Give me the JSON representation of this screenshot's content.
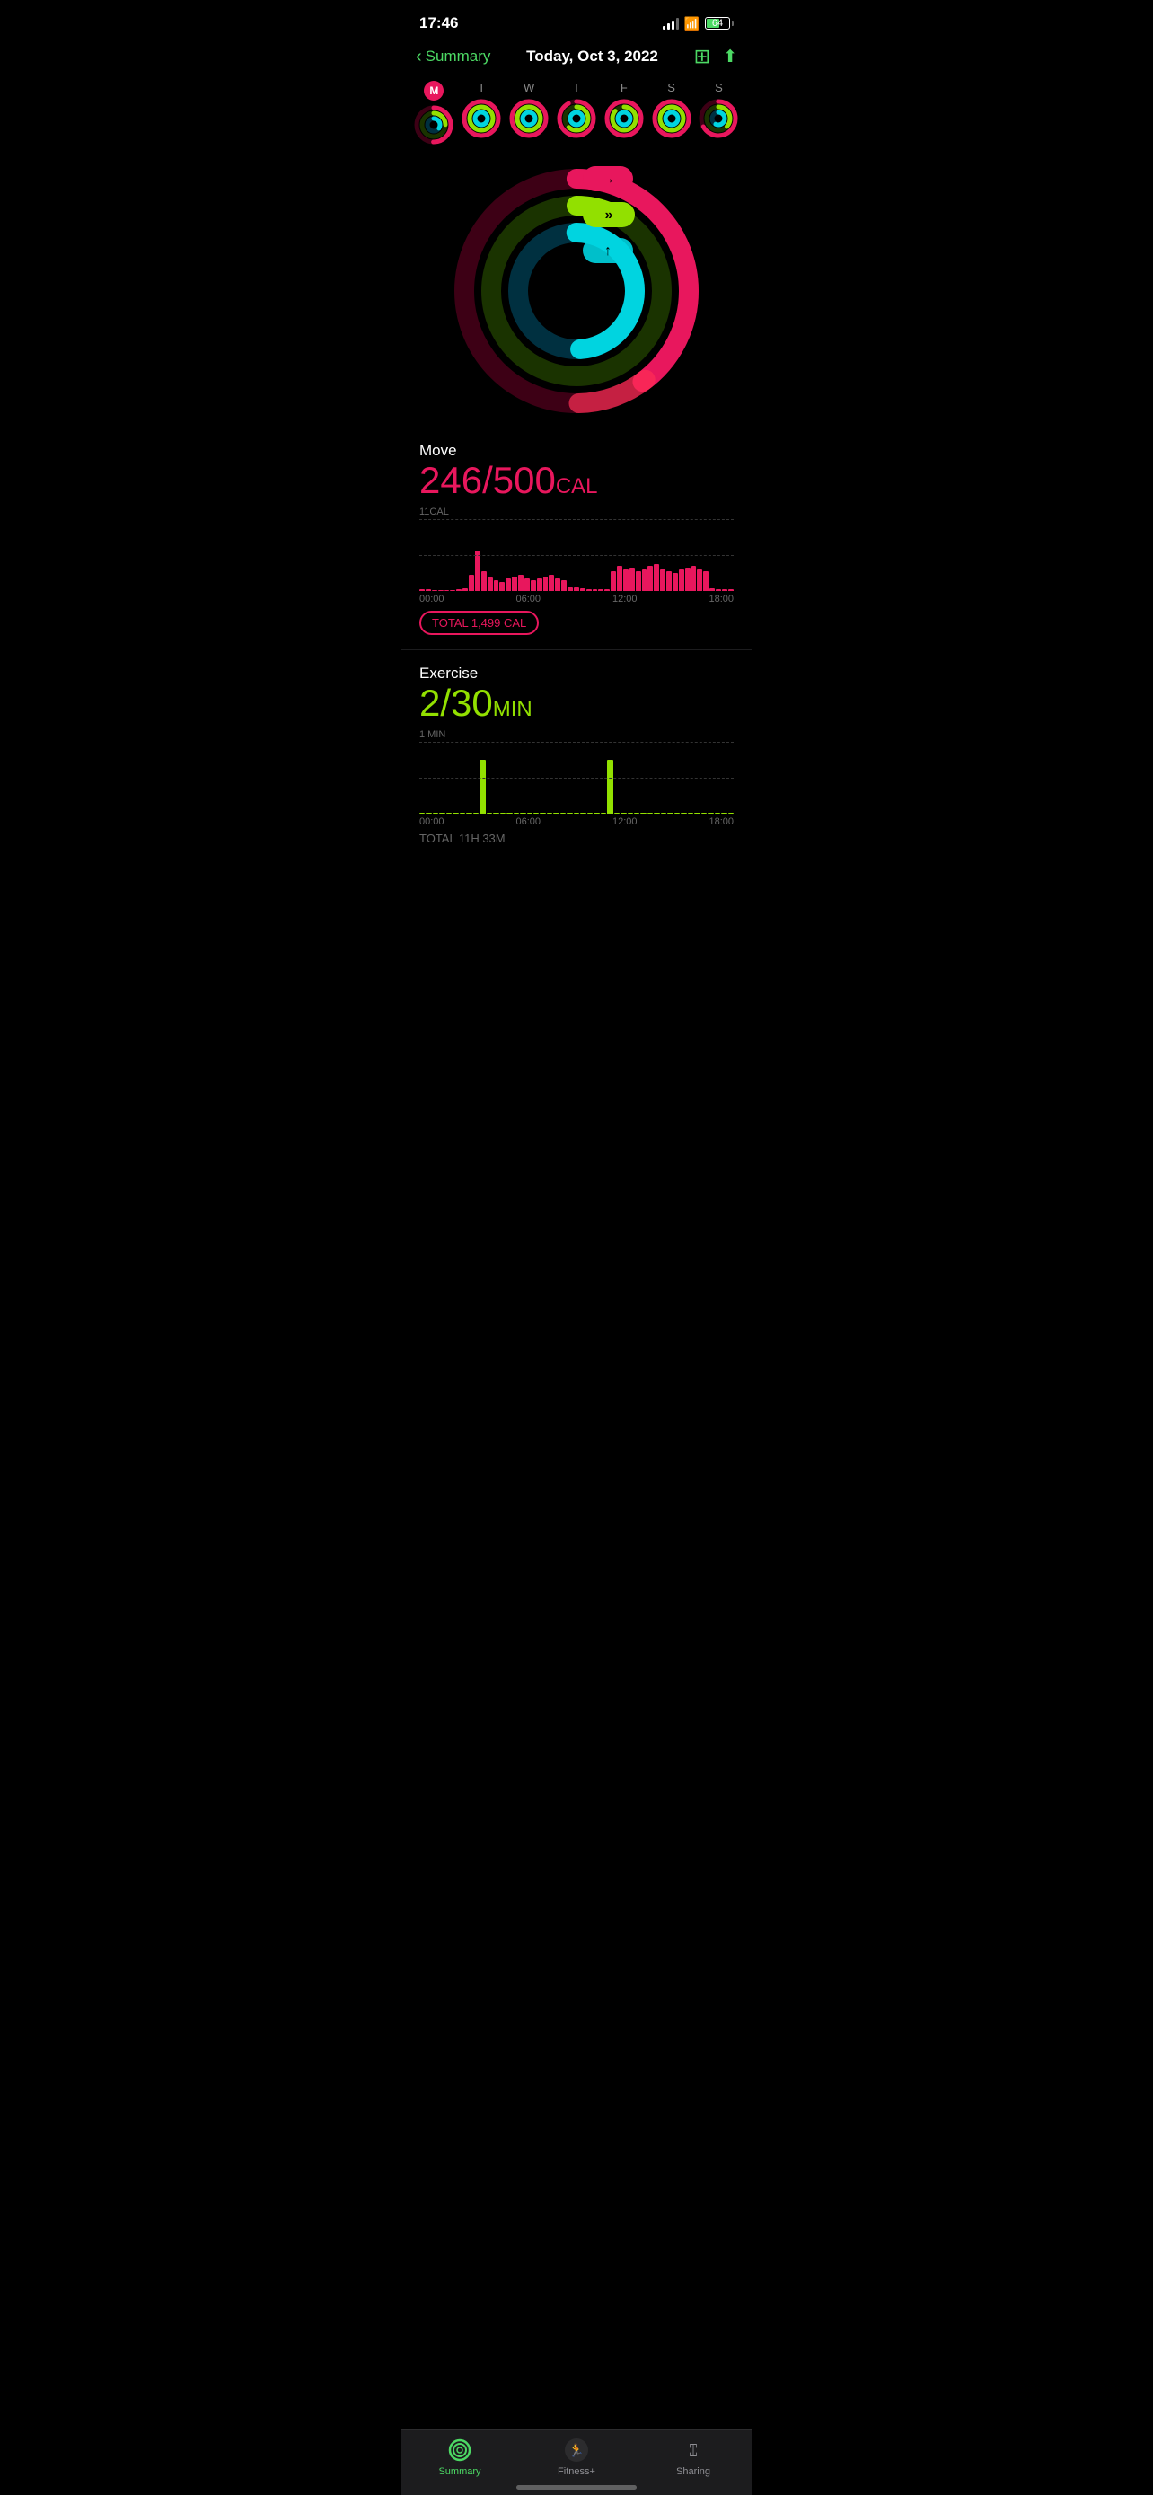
{
  "statusBar": {
    "time": "17:46",
    "battery": "64"
  },
  "header": {
    "backLabel": "Summary",
    "title": "Today, Oct 3, 2022",
    "calendarIcon": "📅",
    "shareIcon": "⬆"
  },
  "days": [
    {
      "label": "M",
      "active": true,
      "today": true
    },
    {
      "label": "T",
      "active": false
    },
    {
      "label": "W",
      "active": false
    },
    {
      "label": "T",
      "active": false
    },
    {
      "label": "F",
      "active": false
    },
    {
      "label": "S",
      "active": false
    },
    {
      "label": "S",
      "active": false
    }
  ],
  "move": {
    "label": "Move",
    "current": "246",
    "goal": "500",
    "unit": "CAL",
    "scaleLabel": "11CAL",
    "totalLabel": "TOTAL 1,499 CAL",
    "color": "#e8175d"
  },
  "exercise": {
    "label": "Exercise",
    "current": "2",
    "goal": "30",
    "unit": "MIN",
    "scaleLabel": "1 MIN",
    "totalLabel": "TOTAL 11H 33M",
    "color": "#92e000"
  },
  "chartTimeLabels": [
    "00:00",
    "06:00",
    "12:00",
    "18:00"
  ],
  "tabs": [
    {
      "label": "Summary",
      "active": true,
      "icon": "activity"
    },
    {
      "label": "Fitness+",
      "active": false,
      "icon": "run"
    },
    {
      "label": "Sharing",
      "active": false,
      "icon": "sharing"
    }
  ]
}
